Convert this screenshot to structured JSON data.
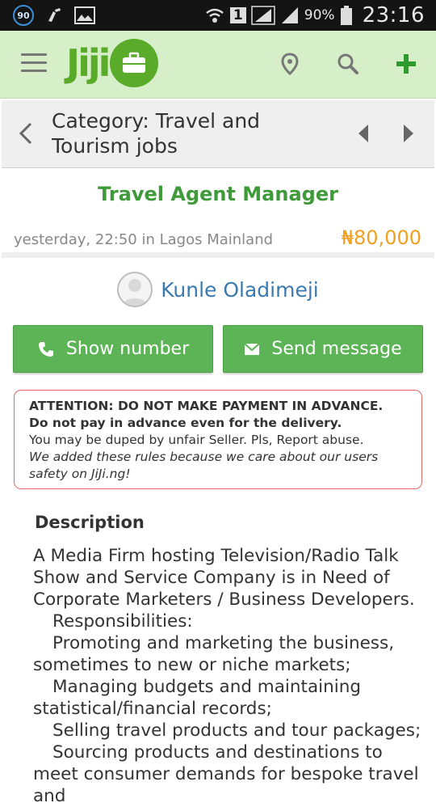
{
  "status_bar": {
    "badge": "90",
    "sim": "1",
    "battery": "90%",
    "time": "23:16"
  },
  "app_bar": {
    "logo": "Jiji",
    "icons": [
      "menu-icon",
      "location-pin-icon",
      "search-icon",
      "plus-icon"
    ],
    "brand_color": "#5aab2a"
  },
  "category_bar": {
    "title": "Category: Travel and Tourism jobs"
  },
  "ad": {
    "title": "Travel Agent Manager",
    "meta": "yesterday, 22:50 in Lagos Mainland",
    "price": "₦80,000"
  },
  "seller": {
    "name": "Kunle Oladimeji"
  },
  "actions": {
    "show_number": "Show number",
    "send_message": "Send message"
  },
  "attention": {
    "line1": "ATTENTION: DO NOT MAKE PAYMENT IN ADVANCE.",
    "line2": "Do not pay in advance even for the delivery.",
    "line3": "You may be duped by unfair Seller. Pls, Report abuse.",
    "line4": "We added these rules because we care about our users safety on JiJi.ng!"
  },
  "description": {
    "heading": "Description",
    "lines": [
      "A Media Firm hosting Television/Radio Talk Show and Service Company is in Need of Corporate Marketers / Business Developers.",
      "Responsibilities:",
      "Promoting and marketing the business, sometimes to new or niche markets;",
      "Managing budgets and maintaining statistical/financial records;",
      "Selling travel products and tour packages;",
      "Sourcing products and destinations to meet consumer demands for bespoke travel and"
    ]
  }
}
